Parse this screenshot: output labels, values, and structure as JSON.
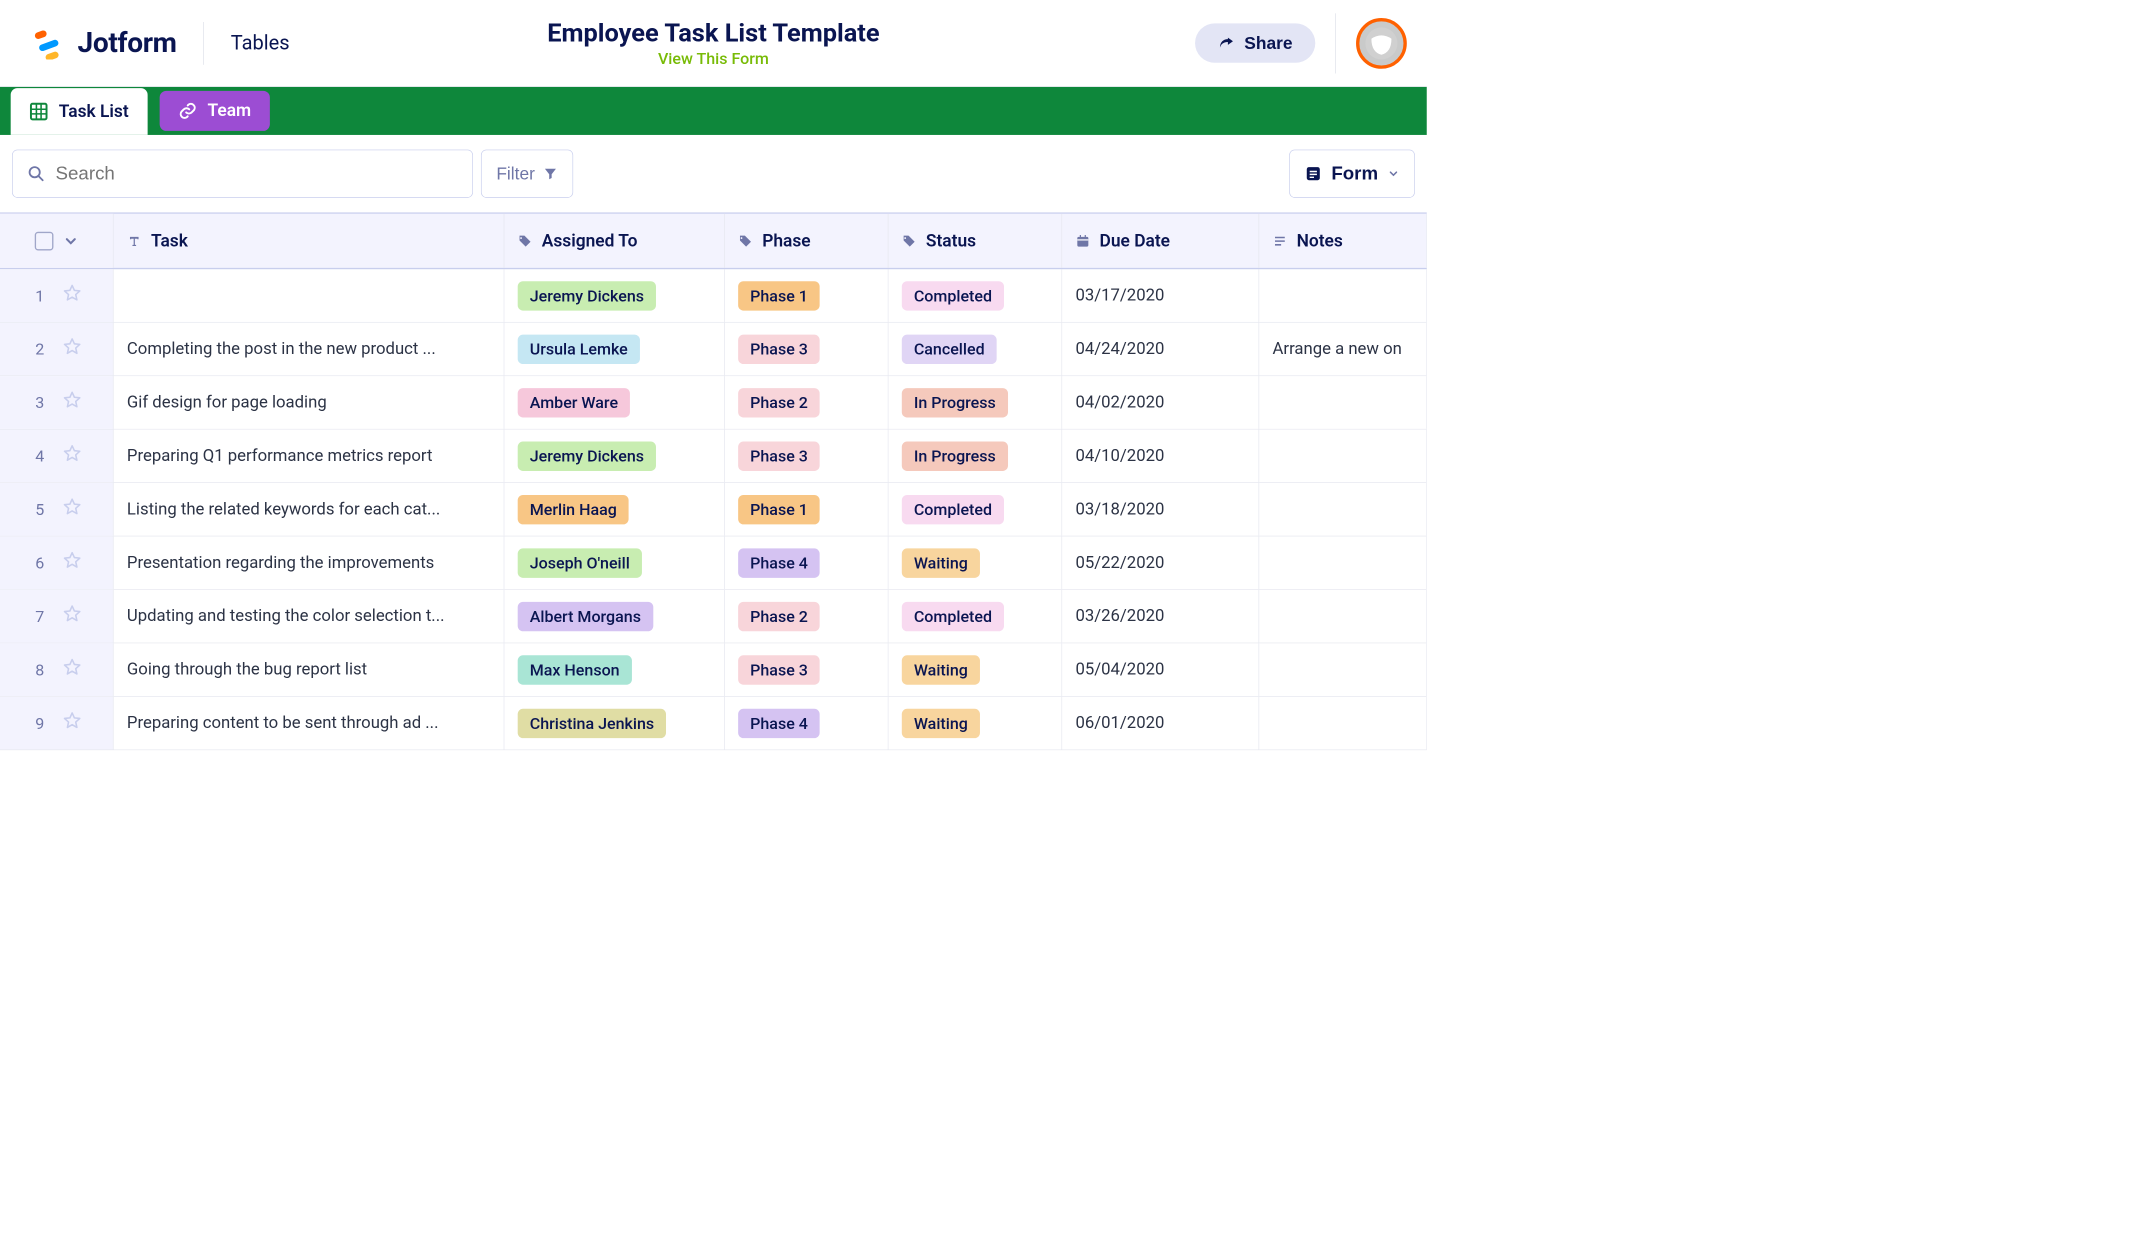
{
  "header": {
    "brand": "Jotform",
    "tables_label": "Tables",
    "title": "Employee Task List Template",
    "subtitle": "View This Form",
    "share_label": "Share"
  },
  "tabs": {
    "task_list": "Task List",
    "team": "Team"
  },
  "toolbar": {
    "search_placeholder": "Search",
    "filter_label": "Filter",
    "form_label": "Form"
  },
  "columns": {
    "task": "Task",
    "assigned": "Assigned To",
    "phase": "Phase",
    "status": "Status",
    "due": "Due Date",
    "notes": "Notes"
  },
  "rows": [
    {
      "num": "1",
      "task": "",
      "assigned": "Jeremy Dickens",
      "assigned_cls": "tag-green",
      "phase": "Phase 1",
      "phase_cls": "tag-orange",
      "status": "Completed",
      "status_cls": "tag-lrosa",
      "due": "03/17/2020",
      "notes": ""
    },
    {
      "num": "2",
      "task": "Completing the post in the new product ...",
      "assigned": "Ursula Lemke",
      "assigned_cls": "tag-lblue",
      "phase": "Phase 3",
      "phase_cls": "tag-lpink",
      "status": "Cancelled",
      "status_cls": "tag-lpurple",
      "due": "04/24/2020",
      "notes": "Arrange a new on"
    },
    {
      "num": "3",
      "task": "Gif design for page loading",
      "assigned": "Amber Ware",
      "assigned_cls": "tag-pink",
      "phase": "Phase 2",
      "phase_cls": "tag-lpink",
      "status": "In Progress",
      "status_cls": "tag-salmon",
      "due": "04/02/2020",
      "notes": ""
    },
    {
      "num": "4",
      "task": "Preparing Q1 performance metrics report",
      "assigned": "Jeremy Dickens",
      "assigned_cls": "tag-green",
      "phase": "Phase 3",
      "phase_cls": "tag-lpink",
      "status": "In Progress",
      "status_cls": "tag-salmon",
      "due": "04/10/2020",
      "notes": ""
    },
    {
      "num": "5",
      "task": "Listing the related keywords for each cat...",
      "assigned": "Merlin Haag",
      "assigned_cls": "tag-orange",
      "phase": "Phase 1",
      "phase_cls": "tag-orange",
      "status": "Completed",
      "status_cls": "tag-lrosa",
      "due": "03/18/2020",
      "notes": ""
    },
    {
      "num": "6",
      "task": "Presentation regarding the improvements",
      "assigned": "Joseph O'neill",
      "assigned_cls": "tag-green",
      "phase": "Phase 4",
      "phase_cls": "tag-purple",
      "status": "Waiting",
      "status_cls": "tag-lorange",
      "due": "05/22/2020",
      "notes": ""
    },
    {
      "num": "7",
      "task": "Updating and testing the color selection t...",
      "assigned": "Albert Morgans",
      "assigned_cls": "tag-purple",
      "phase": "Phase 2",
      "phase_cls": "tag-lpink",
      "status": "Completed",
      "status_cls": "tag-lrosa",
      "due": "03/26/2020",
      "notes": ""
    },
    {
      "num": "8",
      "task": "Going through the bug report list",
      "assigned": "Max Henson",
      "assigned_cls": "tag-mint",
      "phase": "Phase 3",
      "phase_cls": "tag-lpink",
      "status": "Waiting",
      "status_cls": "tag-lorange",
      "due": "05/04/2020",
      "notes": ""
    },
    {
      "num": "9",
      "task": "Preparing content to be sent through ad ...",
      "assigned": "Christina Jenkins",
      "assigned_cls": "tag-khaki",
      "phase": "Phase 4",
      "phase_cls": "tag-purple",
      "status": "Waiting",
      "status_cls": "tag-lorange",
      "due": "06/01/2020",
      "notes": ""
    }
  ]
}
